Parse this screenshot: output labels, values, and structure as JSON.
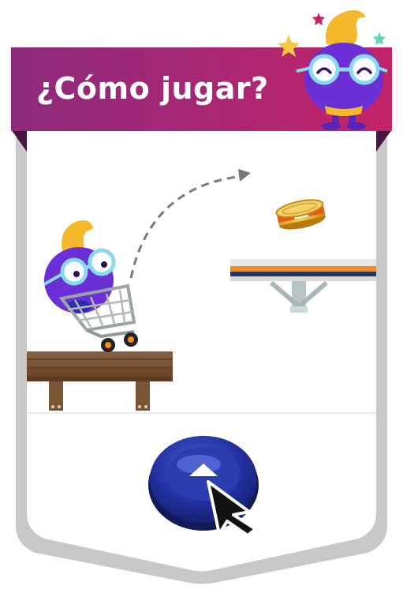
{
  "title": "¿Cómo jugar?",
  "colors": {
    "banner_left": "#8c2a7d",
    "banner_right": "#c3246a",
    "character": "#6c2fd6",
    "hair": "#f5b82a",
    "button": "#1f2f9b",
    "platform_wood": "#7b5434",
    "shelf_orange": "#f28c1b",
    "shelf_blue": "#27375f"
  },
  "icons": {
    "instruction_arrow": "up-arrow-icon",
    "cursor": "pointer-cursor-icon"
  }
}
